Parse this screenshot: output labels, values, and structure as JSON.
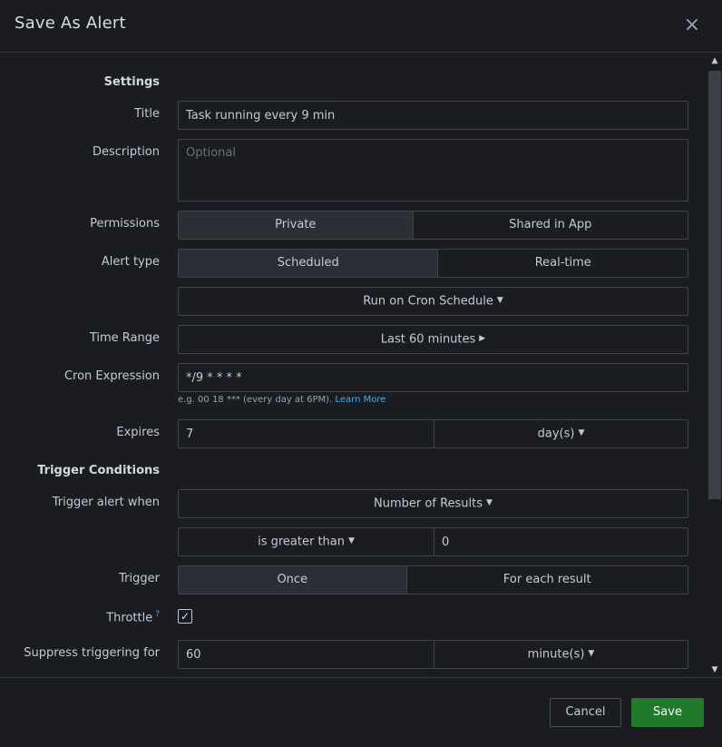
{
  "dialog": {
    "title": "Save As Alert",
    "close_glyph": "×"
  },
  "form": {
    "settings_heading": "Settings",
    "title_label": "Title",
    "title_value": "Task running every 9 min",
    "description_label": "Description",
    "description_placeholder": "Optional",
    "permissions_label": "Permissions",
    "permissions_options": [
      "Private",
      "Shared in App"
    ],
    "permissions_selected": "Private",
    "alert_type_label": "Alert type",
    "alert_type_options": [
      "Scheduled",
      "Real-time"
    ],
    "alert_type_selected": "Scheduled",
    "schedule_dropdown": "Run on Cron Schedule",
    "time_range_label": "Time Range",
    "time_range_value": "Last 60 minutes",
    "cron_label": "Cron Expression",
    "cron_value": "*/9 * * * *",
    "cron_help": "e.g. 00 18 *** (every day at 6PM).",
    "cron_help_link": "Learn More",
    "expires_label": "Expires",
    "expires_value": "7",
    "expires_unit": "day(s)",
    "trigger_heading": "Trigger Conditions",
    "trigger_when_label": "Trigger alert when",
    "trigger_when_value": "Number of Results",
    "comparison_value": "is greater than",
    "threshold_value": "0",
    "trigger_label": "Trigger",
    "trigger_options": [
      "Once",
      "For each result"
    ],
    "trigger_selected": "Once",
    "throttle_label": "Throttle",
    "throttle_help": "?",
    "throttle_checked": true,
    "suppress_label": "Suppress triggering for",
    "suppress_value": "60",
    "suppress_unit": "minute(s)"
  },
  "footer": {
    "cancel_label": "Cancel",
    "save_label": "Save"
  },
  "colors": {
    "background": "#1a1c21",
    "save_button": "#1f7a2c",
    "link": "#4fa7ee"
  }
}
